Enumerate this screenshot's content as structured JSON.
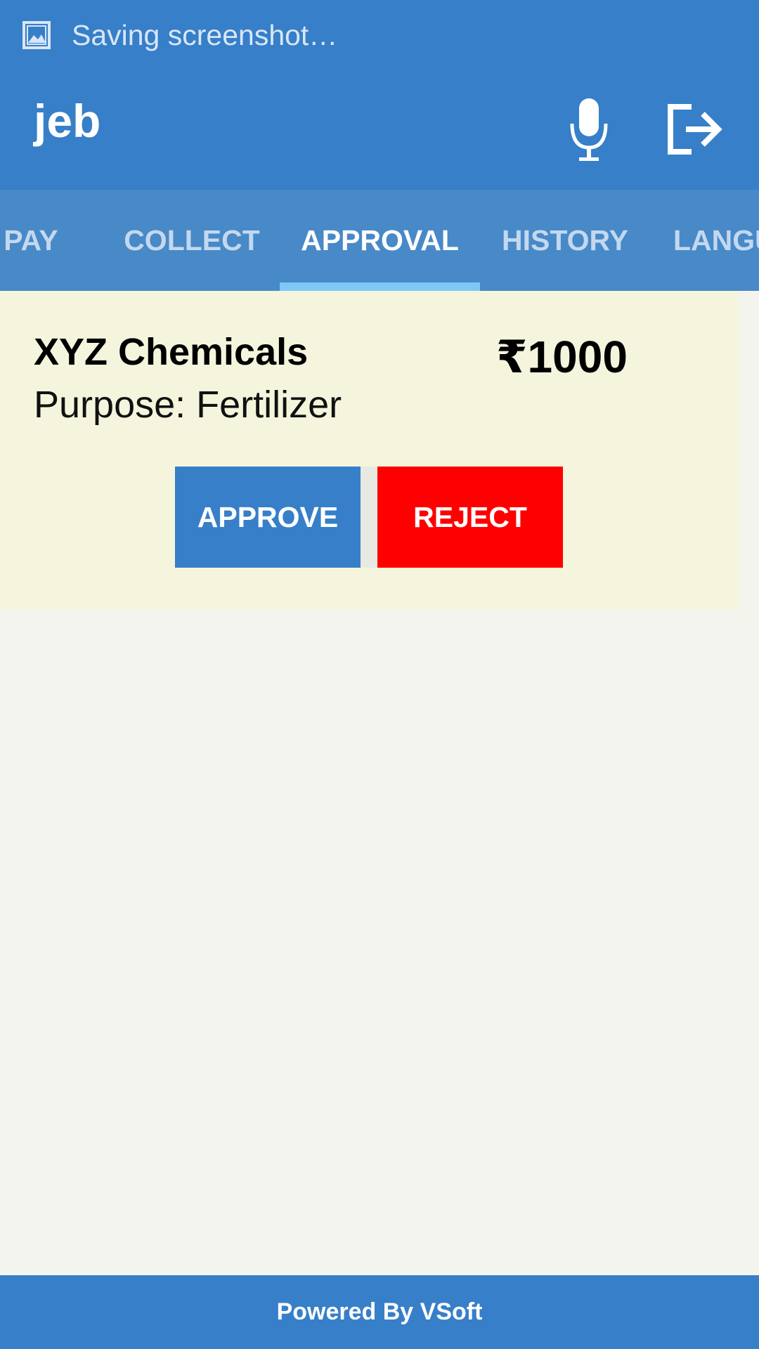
{
  "status_bar": {
    "notification_icon": "image-icon",
    "text": "Saving screenshot…"
  },
  "app_bar": {
    "title": "jeb",
    "mic_icon": "microphone-icon",
    "logout_icon": "logout-icon"
  },
  "tabs": [
    {
      "label": "PAY",
      "active": false
    },
    {
      "label": "COLLECT",
      "active": false
    },
    {
      "label": "APPROVAL",
      "active": true
    },
    {
      "label": "HISTORY",
      "active": false
    },
    {
      "label": "LANGU",
      "active": false
    }
  ],
  "approval": {
    "payee": "XYZ Chemicals",
    "amount": "₹1000",
    "purpose": "Purpose: Fertilizer",
    "approve_label": "APPROVE",
    "reject_label": "REJECT"
  },
  "footer": {
    "text": "Powered By VSoft"
  },
  "colors": {
    "primary": "#377fc8",
    "tab_bar": "#4889c7",
    "tab_indicator": "#7ec8f6",
    "card_background": "#f4f5dc",
    "reject": "#ff0000",
    "page_background": "#f4f4ee"
  }
}
